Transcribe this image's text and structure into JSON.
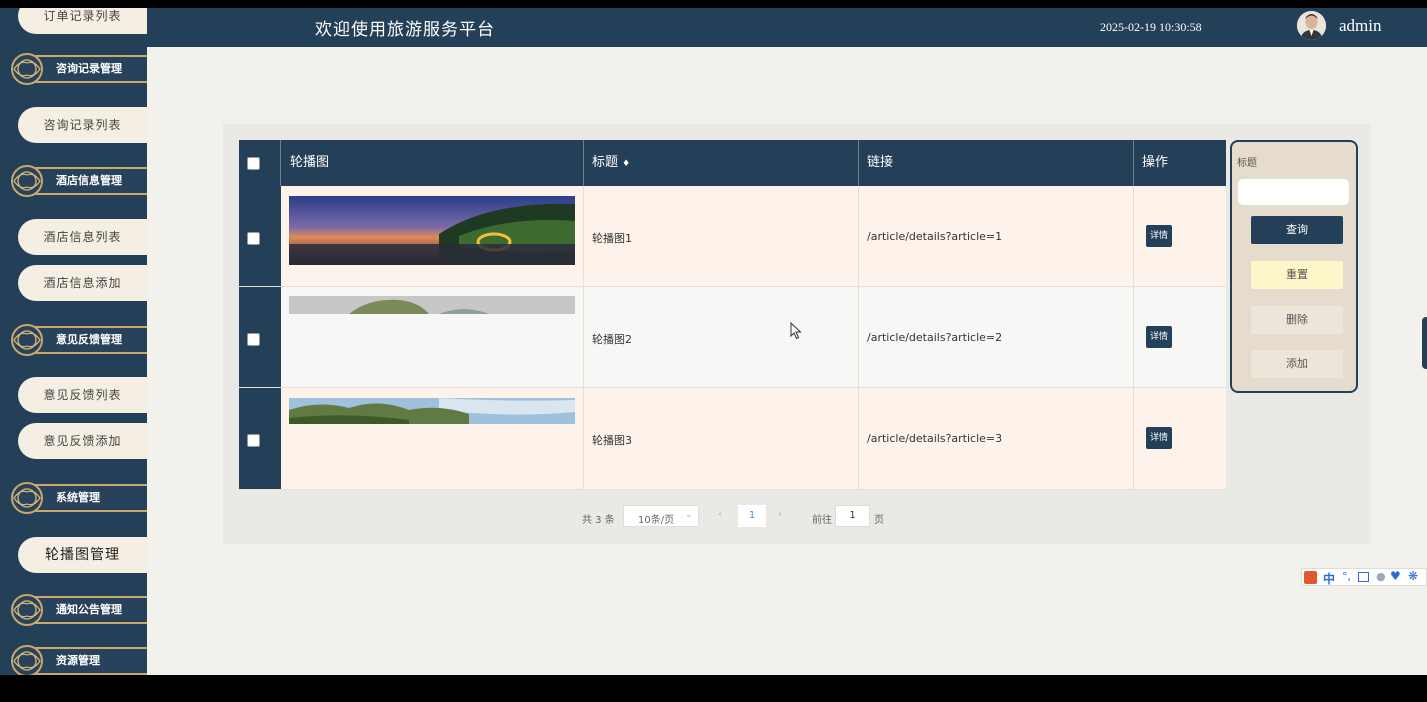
{
  "header": {
    "title": "欢迎使用旅游服务平台",
    "datetime": "2025-02-19 10:30:58",
    "username": "admin"
  },
  "sidebar": {
    "items": [
      {
        "kind": "sub",
        "label": "订单记录列表"
      },
      {
        "kind": "group",
        "label": "咨询记录管理"
      },
      {
        "kind": "sub",
        "label": "咨询记录列表"
      },
      {
        "kind": "group",
        "label": "酒店信息管理"
      },
      {
        "kind": "sub",
        "label": "酒店信息列表"
      },
      {
        "kind": "sub",
        "label": "酒店信息添加"
      },
      {
        "kind": "group",
        "label": "意见反馈管理"
      },
      {
        "kind": "sub",
        "label": "意见反馈列表"
      },
      {
        "kind": "sub",
        "label": "意见反馈添加"
      },
      {
        "kind": "group",
        "label": "系统管理"
      },
      {
        "kind": "sub",
        "label": "轮播图管理"
      },
      {
        "kind": "group",
        "label": "通知公告管理"
      },
      {
        "kind": "group",
        "label": "资源管理"
      }
    ]
  },
  "table": {
    "columns": [
      "轮播图",
      "标题",
      "链接",
      "操作"
    ],
    "sort_icon": "sort-icon",
    "rows": [
      {
        "title": "轮播图1",
        "link": "/article/details?article=1",
        "action": "详情"
      },
      {
        "title": "轮播图2",
        "link": "/article/details?article=2",
        "action": "详情"
      },
      {
        "title": "轮播图3",
        "link": "/article/details?article=3",
        "action": "详情"
      }
    ]
  },
  "search": {
    "label": "标题",
    "input_value": "",
    "buttons": {
      "query": "查询",
      "reset": "重置",
      "delete": "删除",
      "add": "添加"
    }
  },
  "pagination": {
    "total": "共 3 条",
    "page_size": "10条/页",
    "current_page": "1",
    "goto_label": "前往",
    "goto_value": "1",
    "page_unit": "页"
  },
  "ime": {
    "lang": "中"
  },
  "colors": {
    "primary": "#243f58",
    "accent_gold": "#c9a86a",
    "reset_bg": "#fdf6c8"
  }
}
